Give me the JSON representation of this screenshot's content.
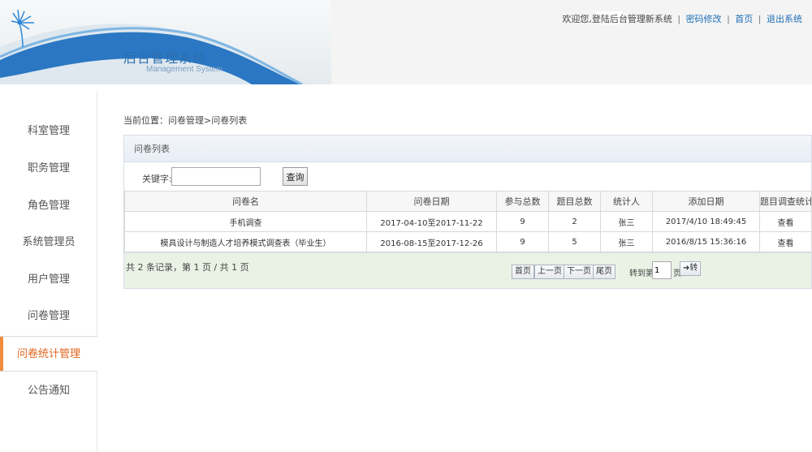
{
  "header": {
    "app_title": "后台管理系统",
    "app_subtitle": "Management System",
    "welcome_text": "欢迎您,登陆后台管理新系统",
    "links": [
      "密码修改",
      "首页",
      "退出系统"
    ],
    "separator": "|"
  },
  "sidebar": {
    "items": [
      {
        "label": "科室管理"
      },
      {
        "label": "职务管理"
      },
      {
        "label": "角色管理"
      },
      {
        "label": "系统管理员"
      },
      {
        "label": "用户管理"
      },
      {
        "label": "问卷管理"
      },
      {
        "label": "问卷统计管理",
        "active": true
      },
      {
        "label": "公告通知"
      }
    ]
  },
  "breadcrumb": "当前位置：问卷管理>问卷列表",
  "panel": {
    "title": "问卷列表",
    "search": {
      "label": "关键字:",
      "value": "",
      "button": "查询"
    },
    "table": {
      "columns": [
        "问卷名",
        "问卷日期",
        "参与总数",
        "题目总数",
        "统计人",
        "添加日期",
        "题目调查统计"
      ],
      "rows": [
        [
          "手机调查",
          "2017-04-10至2017-11-22",
          "9",
          "2",
          "张三",
          "2017/4/10 18:49:45",
          "查看"
        ],
        [
          "模具设计与制造人才培养模式调查表（毕业生）",
          "2016-08-15至2017-12-26",
          "9",
          "5",
          "张三",
          "2016/8/15 15:36:16",
          "查看"
        ]
      ]
    },
    "pager": {
      "record_info": "共 2 条记录，第 1 页 / 共 1 页",
      "buttons": [
        "首页",
        "上一页",
        "下一页",
        "尾页"
      ],
      "goto_label": "转到第",
      "page_value": "1",
      "page_unit": "页",
      "goto_button": "➜转"
    }
  },
  "colors": {
    "accent": "#2b6fb1",
    "active_nav": "#e0641c",
    "pager_bg": "#eaf2e6"
  }
}
